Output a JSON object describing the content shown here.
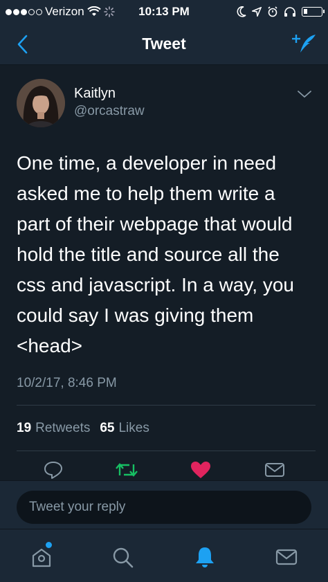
{
  "status_bar": {
    "carrier": "Verizon",
    "time": "10:13 PM"
  },
  "nav": {
    "title": "Tweet"
  },
  "tweet": {
    "author_name": "Kaitlyn",
    "author_handle": "@orcastraw",
    "text_lines": [
      "One time, a developer in need",
      "asked me to help them write a",
      "part of their webpage that would",
      "hold the title and source all the",
      "css and javascript. In a way, you",
      "could say I was giving them",
      "<head>"
    ],
    "timestamp": "10/2/17, 8:46 PM",
    "retweets_count": "19",
    "retweets_label": "Retweets",
    "likes_count": "65",
    "likes_label": "Likes"
  },
  "reply": {
    "placeholder": "Tweet your reply"
  },
  "colors": {
    "accent": "#1da1f2",
    "retweet": "#17bf63",
    "like": "#e0245e",
    "muted": "#8899a6",
    "background": "#141d26",
    "bar": "#1b2836"
  },
  "icons": {
    "back": "chevron-left-icon",
    "compose": "compose-icon",
    "more": "chevron-down-icon",
    "reply": "reply-icon",
    "retweet": "retweet-icon",
    "like": "heart-icon",
    "message": "envelope-icon",
    "home": "home-icon",
    "search": "search-icon",
    "notifications": "bell-icon",
    "messages": "envelope-icon"
  }
}
